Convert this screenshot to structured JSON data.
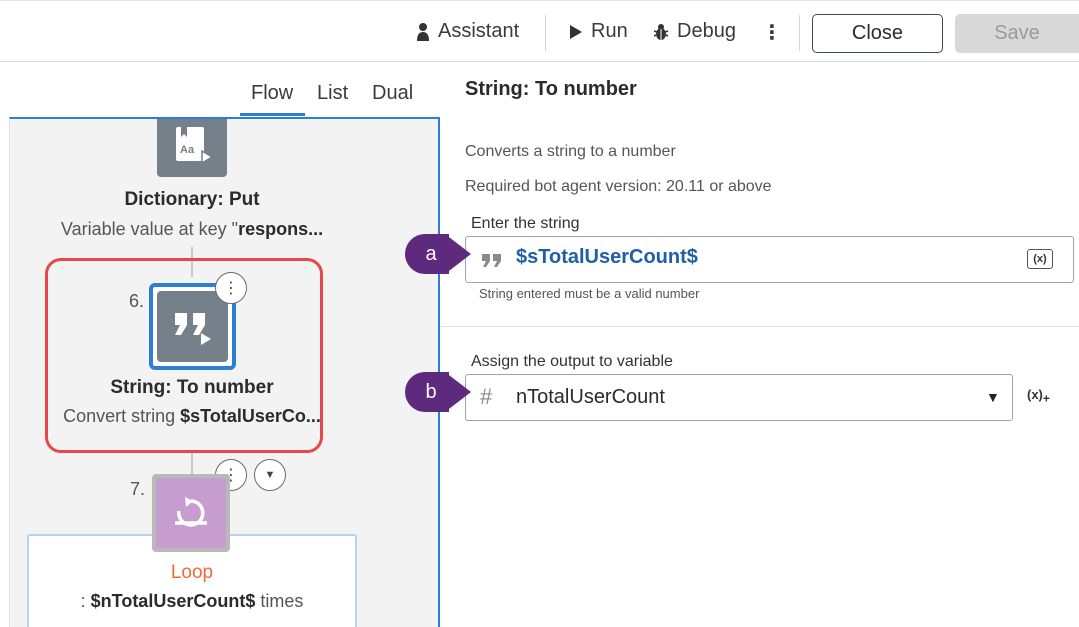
{
  "toolbar": {
    "assistant_label": "Assistant",
    "run_label": "Run",
    "debug_label": "Debug",
    "more_label": "⋮",
    "close_label": "Close",
    "save_label": "Save"
  },
  "left": {
    "tabs": [
      {
        "label": "Flow",
        "active": true
      },
      {
        "label": "List",
        "active": false
      },
      {
        "label": "Dual",
        "active": false
      }
    ],
    "nodes": {
      "dict_put": {
        "icon_text": "Aa",
        "title": "Dictionary: Put",
        "desc_prefix": "Variable value at key \"",
        "desc_bold": "respons..."
      },
      "to_number": {
        "step": "6.",
        "title": "String: To number",
        "desc_prefix": "Convert string ",
        "desc_bold": "$sTotalUserCo..."
      },
      "loop": {
        "step": "7.",
        "title": "Loop",
        "desc_prefix": ": ",
        "desc_bold": "$nTotalUserCount$",
        "desc_suffix": " times"
      }
    }
  },
  "right": {
    "title": "String: To number",
    "description": "Converts a string to a number",
    "version": "Required bot agent version: 20.11 or above",
    "string_field": {
      "label": "Enter the string",
      "value": "$sTotalUserCount$",
      "hint": "String entered must be a valid number",
      "var_button": "(x)"
    },
    "output_field": {
      "label": "Assign the output to variable",
      "value": "nTotalUserCount",
      "var_button": "(x)"
    }
  },
  "callouts": [
    "a",
    "b"
  ],
  "colors": {
    "accent": "#2c7fd3",
    "highlight": "#e6474a",
    "callout": "#5d2a7e",
    "loop_icon": "#c79ccf",
    "loop_title": "#f06a3a",
    "node_icon": "#75808a"
  }
}
